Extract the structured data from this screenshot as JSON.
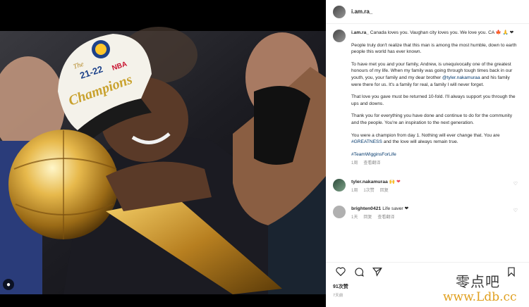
{
  "post": {
    "username": "i.am.ra_",
    "caption_lead": "Canada loves you. Vaughan city loves you. We love you.",
    "caption_flags": "CA 🍁 🙏 ❤",
    "paragraphs": [
      "People truly don't realize that this man is among the most humble, down to earth people this world has ever known.",
      "To have met you and your family, Andrew, is unequivocally one of the greatest honours of my life. When my family was going through tough times back in our youth, you, your family and my dear brother",
      "and his family were there for us. It's a family for real, a family I will never forget.",
      "That love you gave must be returned 10-fold. I'll always support you through the ups and downs.",
      "Thank you for everything you have done and continue to do for the community and the people. You're an inspiration to the next generation.",
      "You were a champion from day 1. Nothing will ever change that. You are",
      "and the love will always remain true."
    ],
    "mention": "@tyler.nakamuraa",
    "hashtag_greatness": "#GREATNESS",
    "hashtag_wiggins": "#TeamWigginsForLife",
    "caption_meta": {
      "age": "1周",
      "translate": "查看翻译"
    },
    "likes": "91次赞",
    "post_age": "7天前"
  },
  "comments": [
    {
      "user": "tyler.nakamuraa",
      "text": "🙌 ❤",
      "age": "1周",
      "likes": "1次赞",
      "reply": "回复"
    },
    {
      "user": "brighten0421",
      "text": "Life saver ❤",
      "age": "1天",
      "reply": "回复",
      "translate": "查看翻译"
    }
  ],
  "photo": {
    "hat_text_top": "The",
    "hat_year": "21-22",
    "hat_league": "NBA",
    "hat_title": "Champions"
  },
  "watermark": {
    "cn": "零点吧",
    "url": "www.Ldb.cc"
  },
  "icons": [
    "user-tag-icon",
    "heart-icon",
    "comment-icon",
    "share-icon",
    "bookmark-icon",
    "more-icon"
  ]
}
